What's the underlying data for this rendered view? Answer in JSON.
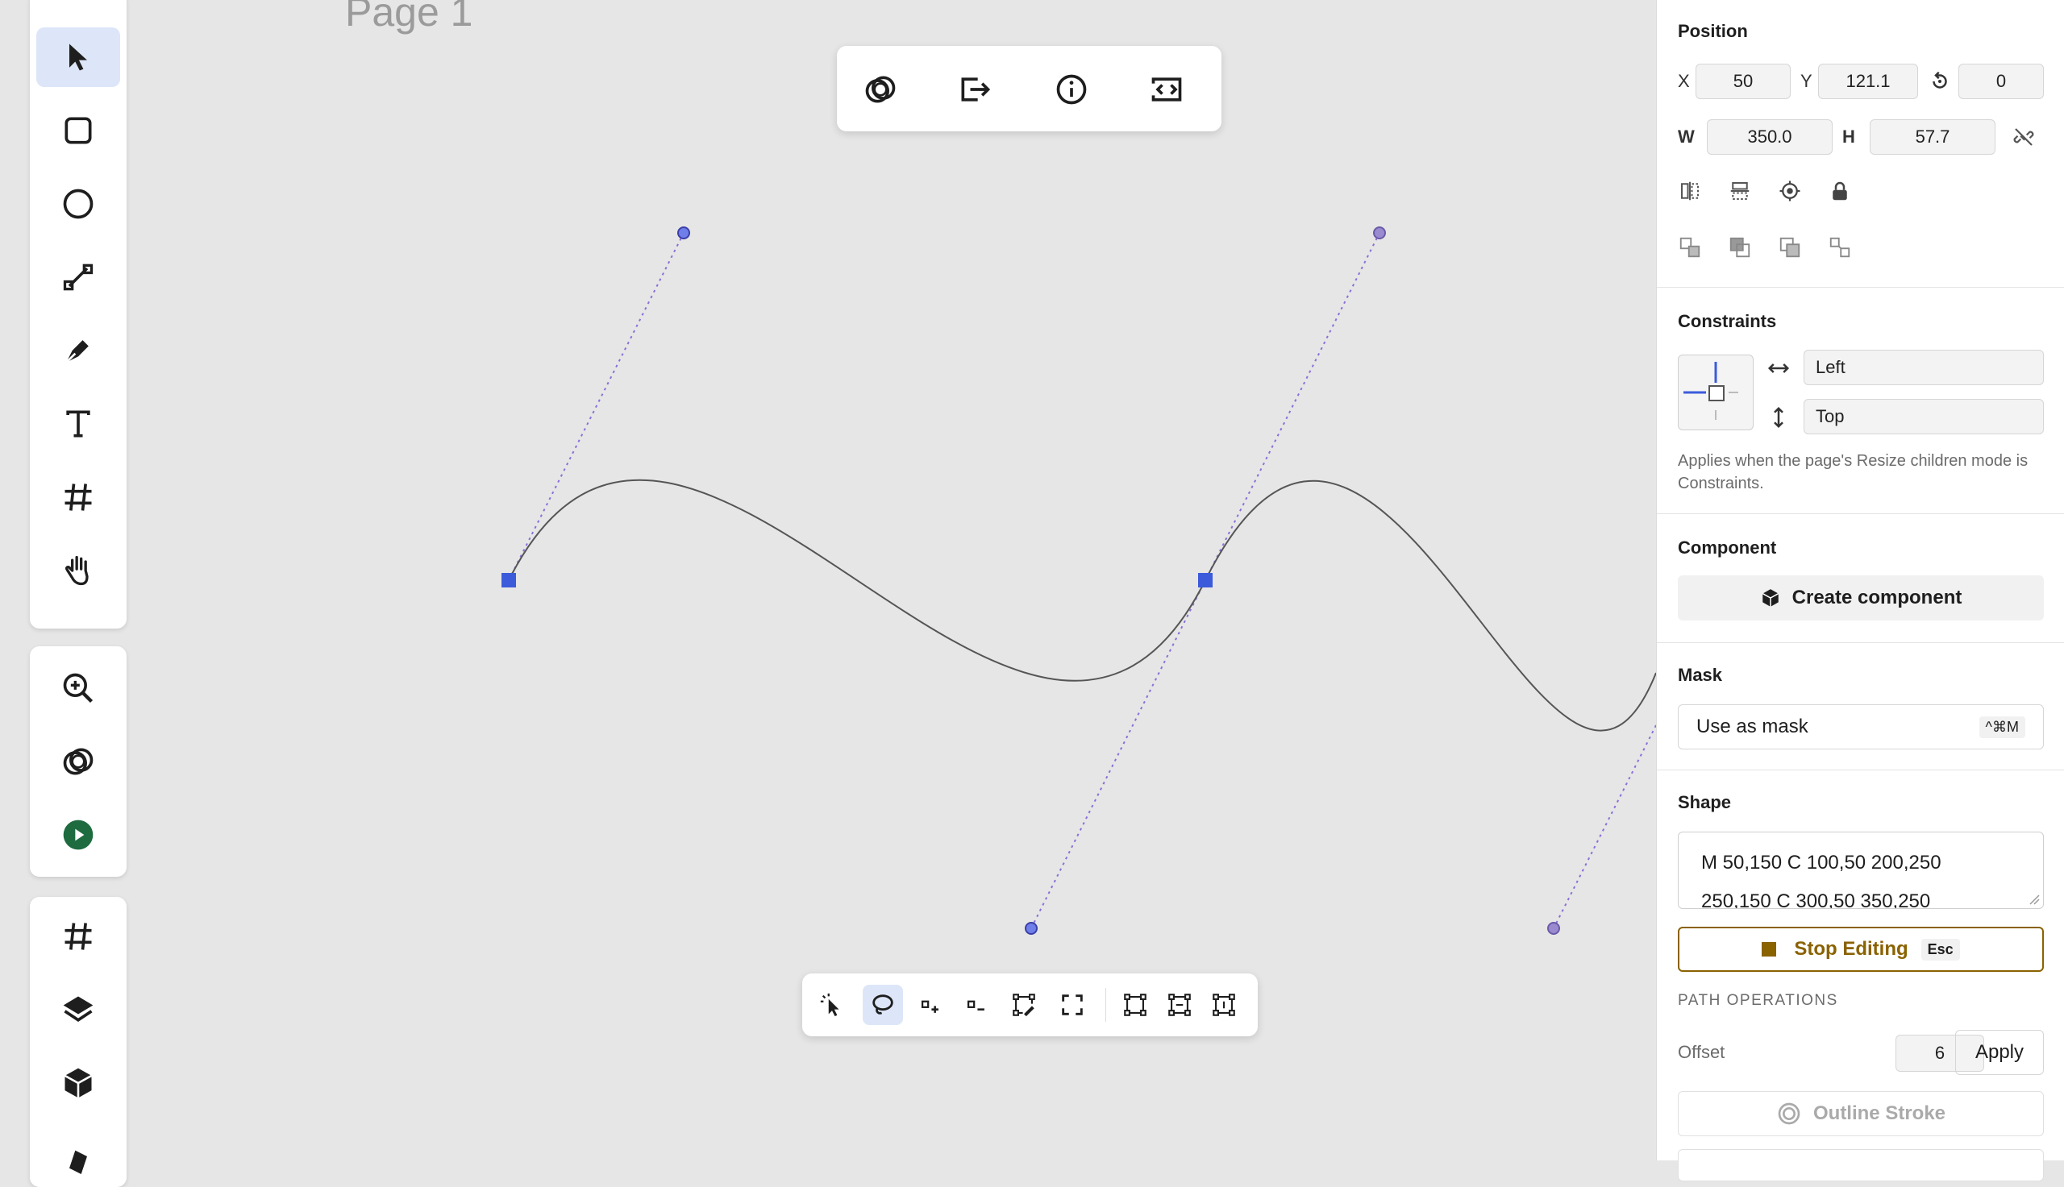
{
  "canvas": {
    "page_label": "Page 1"
  },
  "left_toolbar": {
    "tools": [
      "pointer-icon",
      "rectangle-icon",
      "ellipse-icon",
      "line-icon",
      "pen-icon",
      "text-icon",
      "frame-icon",
      "hand-icon"
    ],
    "secondary": [
      "zoom-icon",
      "boolean-icon",
      "play-icon"
    ],
    "tertiary": [
      "frame-icon",
      "layers-icon",
      "component-icon",
      "partial-icon"
    ]
  },
  "top_toolbar": {
    "buttons": [
      "boolean-icon",
      "export-icon",
      "info-icon",
      "code-icon"
    ]
  },
  "path_toolbar": {
    "buttons": [
      "direct-select-icon",
      "lasso-icon",
      "add-point-icon",
      "remove-point-icon",
      "edit-path-icon",
      "close-path-icon",
      "align-left-nodes-icon",
      "align-center-nodes-icon",
      "align-right-nodes-icon"
    ]
  },
  "panel": {
    "position": {
      "title": "Position",
      "x_label": "X",
      "x_value": "50",
      "y_label": "Y",
      "y_value": "121.1",
      "rotation_value": "0",
      "w_label": "W",
      "w_value": "350.0",
      "h_label": "H",
      "h_value": "57.7"
    },
    "constraints": {
      "title": "Constraints",
      "horizontal": "Left",
      "vertical": "Top",
      "note": "Applies when the page's Resize children mode is Constraints."
    },
    "component": {
      "title": "Component",
      "create_label": "Create component"
    },
    "mask": {
      "title": "Mask",
      "use_label": "Use as mask",
      "shortcut": "^⌘M"
    },
    "shape": {
      "title": "Shape",
      "path_line1": "M 50,150 C 100,50 200,250",
      "path_line2": "250,150 C 300,50 350,250",
      "stop_label": "Stop Editing",
      "stop_shortcut": "Esc",
      "path_ops_title": "PATH OPERATIONS",
      "offset_label": "Offset",
      "offset_value": "6",
      "apply_label": "Apply",
      "outline_label": "Outline Stroke"
    }
  },
  "colors": {
    "accent": "#3b5bdb",
    "canvas_bg": "#e6e6e6",
    "stop_editing": "#8a6200"
  }
}
